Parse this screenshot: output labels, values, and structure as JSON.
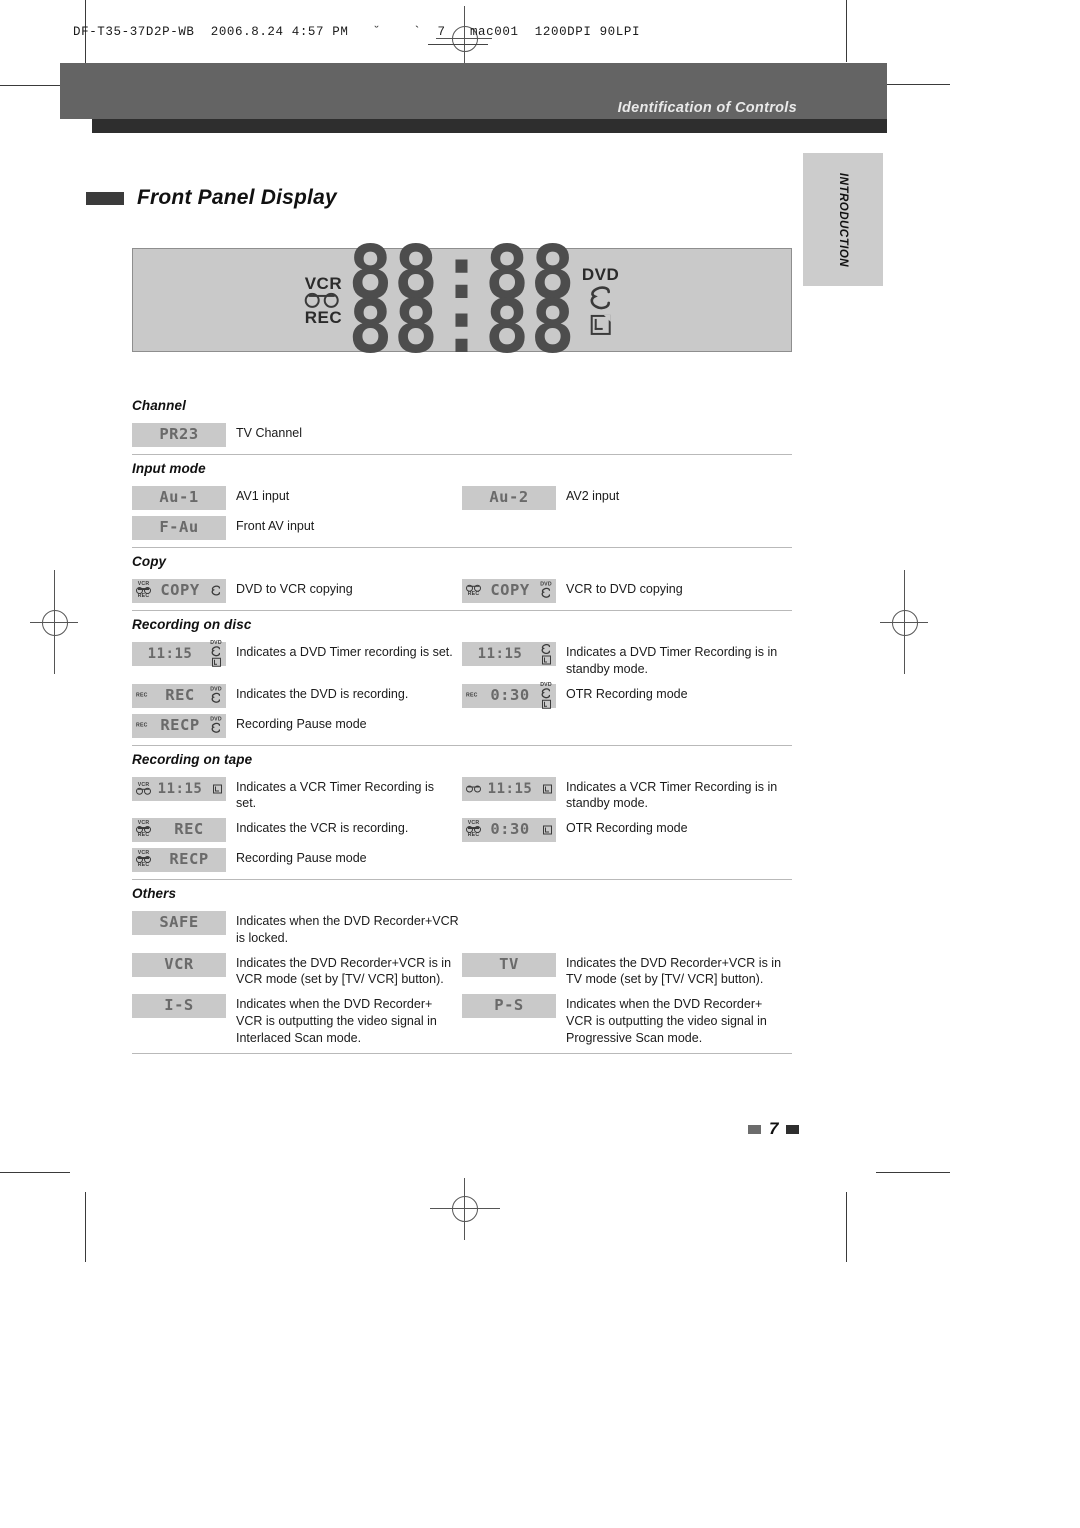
{
  "slug": {
    "text": "DF-T35-37D2P-WB  2006.8.24 4:57 PM   ˘    `  7   mac001  1200DPI 90LPI"
  },
  "header": {
    "running_title": "Identification of Controls",
    "side_tab": "INTRODUCTION"
  },
  "section": {
    "title": "Front Panel Display"
  },
  "panel": {
    "label_vcr": "VCR",
    "label_rec": "REC",
    "label_dvd": "DVD",
    "digits_top": "88:88",
    "digits_bottom": "88:88",
    "icon_reel": "tape-reel-icon",
    "icon_disc": "disc-icon",
    "icon_rec_disc": "recordable-disc-icon"
  },
  "groups": [
    {
      "title": "Channel",
      "rows": [
        [
          {
            "seg": "PR23",
            "desc": "TV Channel",
            "vcr": false,
            "rec": false,
            "reel": false,
            "dvd": false,
            "disc": false,
            "lbox": false
          }
        ]
      ]
    },
    {
      "title": "Input mode",
      "rows": [
        [
          {
            "seg": "Au-1",
            "desc": "AV1 input",
            "vcr": false,
            "rec": false,
            "reel": false,
            "dvd": false,
            "disc": false,
            "lbox": false
          },
          {
            "seg": "Au-2",
            "desc": "AV2 input",
            "vcr": false,
            "rec": false,
            "reel": false,
            "dvd": false,
            "disc": false,
            "lbox": false
          }
        ],
        [
          {
            "seg": "F-Au",
            "desc": "Front AV input",
            "vcr": false,
            "rec": false,
            "reel": false,
            "dvd": false,
            "disc": false,
            "lbox": false
          }
        ]
      ]
    },
    {
      "title": "Copy",
      "rows": [
        [
          {
            "seg": "COPY",
            "desc": "DVD to VCR copying",
            "vcr": true,
            "rec": true,
            "reel": true,
            "dvd": false,
            "disc": true,
            "lbox": false
          },
          {
            "seg": "COPY",
            "desc": "VCR to DVD copying",
            "vcr": false,
            "rec": true,
            "reel": true,
            "dvd": true,
            "disc": true,
            "lbox": false
          }
        ]
      ]
    },
    {
      "title": "Recording on disc",
      "rows": [
        [
          {
            "seg": "11:15",
            "desc": "Indicates a DVD Timer recording is set.",
            "vcr": false,
            "rec": false,
            "reel": false,
            "dvd": true,
            "disc": true,
            "lbox": true
          },
          {
            "seg": "11:15",
            "desc": "Indicates a DVD Timer Recording is in standby mode.",
            "vcr": false,
            "rec": false,
            "reel": false,
            "dvd": false,
            "disc": true,
            "lbox": true
          }
        ],
        [
          {
            "seg": "REC",
            "desc": "Indicates the DVD is recording.",
            "vcr": false,
            "rec": true,
            "reel": false,
            "dvd": true,
            "disc": true,
            "lbox": false
          },
          {
            "seg": "0:30",
            "desc": "OTR Recording mode",
            "vcr": false,
            "rec": true,
            "reel": false,
            "dvd": true,
            "disc": true,
            "lbox": true
          }
        ],
        [
          {
            "seg": "RECP",
            "desc": "Recording Pause mode",
            "vcr": false,
            "rec": true,
            "reel": false,
            "dvd": true,
            "disc": true,
            "lbox": false
          }
        ]
      ]
    },
    {
      "title": "Recording on tape",
      "rows": [
        [
          {
            "seg": "11:15",
            "desc": "Indicates a VCR Timer Recording is set.",
            "vcr": true,
            "rec": false,
            "reel": true,
            "dvd": false,
            "disc": false,
            "lbox": true
          },
          {
            "seg": "11:15",
            "desc": "Indicates a VCR Timer Recording is in standby mode.",
            "vcr": false,
            "rec": false,
            "reel": true,
            "dvd": false,
            "disc": false,
            "lbox": true
          }
        ],
        [
          {
            "seg": "REC",
            "desc": "Indicates the VCR is recording.",
            "vcr": true,
            "rec": true,
            "reel": true,
            "dvd": false,
            "disc": false,
            "lbox": false
          },
          {
            "seg": "0:30",
            "desc": "OTR Recording mode",
            "vcr": true,
            "rec": true,
            "reel": true,
            "dvd": false,
            "disc": false,
            "lbox": true
          }
        ],
        [
          {
            "seg": "RECP",
            "desc": "Recording Pause mode",
            "vcr": true,
            "rec": true,
            "reel": true,
            "dvd": false,
            "disc": false,
            "lbox": false
          }
        ]
      ]
    },
    {
      "title": "Others",
      "rows": [
        [
          {
            "seg": "SAFE",
            "desc": "Indicates when the DVD Recorder+VCR is locked.",
            "vcr": false,
            "rec": false,
            "reel": false,
            "dvd": false,
            "disc": false,
            "lbox": false
          }
        ],
        [
          {
            "seg": "VCR",
            "desc": "Indicates the DVD Recorder+VCR is in VCR mode (set by [TV/ VCR] button).",
            "vcr": false,
            "rec": false,
            "reel": false,
            "dvd": false,
            "disc": false,
            "lbox": false
          },
          {
            "seg": "TV",
            "desc": "Indicates the DVD Recorder+VCR is in TV mode (set by [TV/ VCR] button).",
            "vcr": false,
            "rec": false,
            "reel": false,
            "dvd": false,
            "disc": false,
            "lbox": false
          }
        ],
        [
          {
            "seg": "I-S",
            "desc": "Indicates when the DVD Recorder+ VCR is outputting the video signal in Interlaced Scan mode.",
            "vcr": false,
            "rec": false,
            "reel": false,
            "dvd": false,
            "disc": false,
            "lbox": false
          },
          {
            "seg": "P-S",
            "desc": "Indicates when the DVD Recorder+ VCR is outputting the video signal in Progressive Scan mode.",
            "vcr": false,
            "rec": false,
            "reel": false,
            "dvd": false,
            "disc": false,
            "lbox": false
          }
        ]
      ]
    }
  ],
  "footer": {
    "page": "7"
  },
  "colors": {
    "band": "#646464",
    "band_dark": "#2e2e2e",
    "badge": "#c9c9c9",
    "segment_text": "#6a6a6a"
  }
}
